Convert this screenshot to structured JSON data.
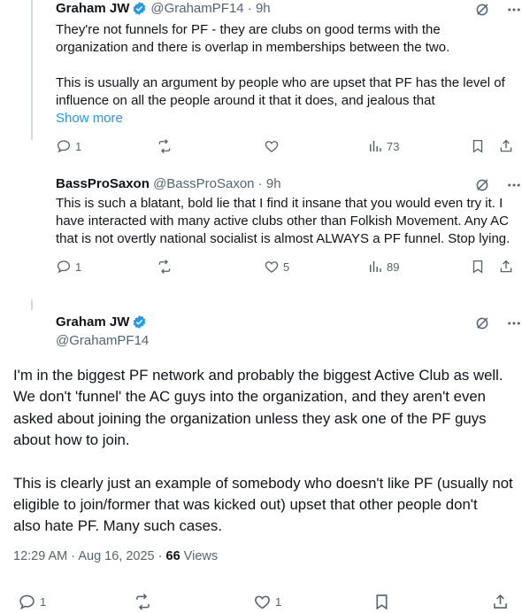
{
  "reply1": {
    "name": "Graham JW",
    "handle": "@GrahamPF14",
    "time": "9h",
    "lines": [
      "They're not funnels for PF - they are clubs on good terms with the",
      "organization and there is overlap in memberships between the two.",
      "",
      "This is usually an argument by people who are upset that PF has the level of",
      "influence on all the people around it that it does, and jealous that"
    ],
    "show_more": "Show more",
    "replies": "1",
    "reposts": "",
    "likes": "",
    "views": "73"
  },
  "reply2": {
    "name": "BassProSaxon",
    "handle": "@BassProSaxon",
    "time": "9h",
    "lines": [
      "This is such a blatant, bold lie that I find it insane that you would even try it. I",
      "have interacted with many active clubs other than Folkish Movement.  Any AC",
      "that is not overtly national socialist is almost ALWAYS a PF funnel. Stop lying."
    ],
    "replies": "1",
    "reposts": "",
    "likes": "5",
    "views": "89"
  },
  "main": {
    "name": "Graham JW",
    "handle": "@GrahamPF14",
    "p1": [
      "I'm in the biggest PF network and probably the biggest Active Club as well.",
      "We don't 'funnel' the AC guys into the organization, and they aren't even",
      "asked about joining the organization unless they ask one of the PF guys",
      "about how to join."
    ],
    "p2": [
      "This is clearly just an example of somebody who doesn't like PF (usually not",
      "eligible to join/former that was kicked out) upset that other people don't",
      "also hate PF. Many such cases."
    ],
    "time": "12:29 AM · Aug 16, 2025 · ",
    "views_count": "66",
    "views_label": " Views",
    "replies": "1",
    "reposts": "",
    "likes": "1"
  },
  "colors": {
    "accent": "#1d9bf0",
    "muted": "#536471",
    "text": "#0f1419",
    "line": "#cfd9de"
  }
}
